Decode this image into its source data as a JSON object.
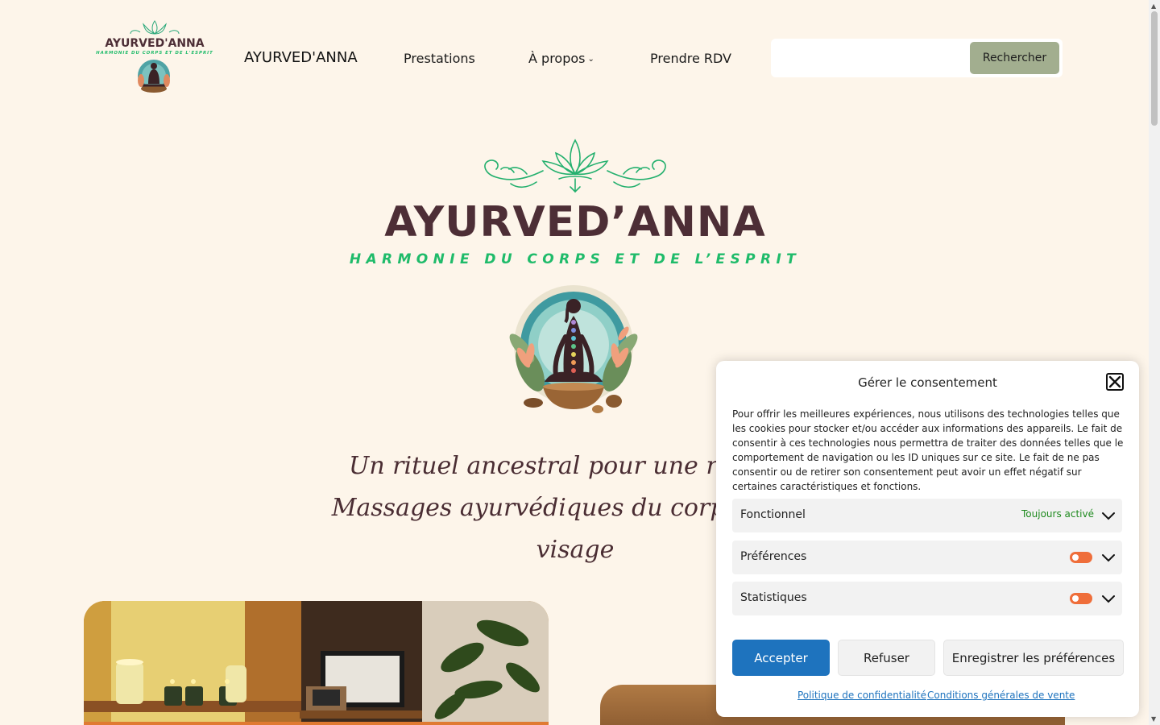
{
  "header": {
    "logo_text": "AYURVED'ANNA",
    "logo_tagline": "HARMONIE DU CORPS ET DE L'ESPRIT",
    "site_title": "AYURVED'ANNA",
    "nav": [
      {
        "label": "Prestations"
      },
      {
        "label": "À propos",
        "has_dropdown": true
      },
      {
        "label": "Prendre RDV"
      }
    ],
    "search": {
      "value": "",
      "placeholder": "",
      "button_label": "Rechercher"
    }
  },
  "hero": {
    "title": "AYURVED’ANNA",
    "subtitle": "HARMONIE DU CORPS ET DE L’ESPRIT",
    "tagline_lines": [
      "Un rituel ancestral pour une relation",
      "Massages ayurvédiques du corps entier",
      "visage"
    ]
  },
  "consent": {
    "title": "Gérer le consentement",
    "text": "Pour offrir les meilleures expériences, nous utilisons des technologies telles que les cookies pour stocker et/ou accéder aux informations des appareils. Le fait de consentir à ces technologies nous permettra de traiter des données telles que le comportement de navigation ou les ID uniques sur ce site. Le fait de ne pas consentir ou de retirer son consentement peut avoir un effet négatif sur certaines caractéristiques et fonctions.",
    "categories": [
      {
        "label": "Fonctionnel",
        "status": "Toujours activé"
      },
      {
        "label": "Préférences",
        "enabled": false
      },
      {
        "label": "Statistiques",
        "enabled": false
      }
    ],
    "buttons": {
      "accept": "Accepter",
      "refuse": "Refuser",
      "save": "Enregistrer les préférences"
    },
    "links": {
      "privacy": "Politique de confidentialité",
      "terms": "Conditions générales de vente"
    }
  },
  "colors": {
    "background": "#fdf5ea",
    "brand_plum": "#4d2e36",
    "brand_green": "#1fbb6a",
    "search_button": "#a2ae8f",
    "accept_button": "#1e73be",
    "toggle_off": "#ef6e3a"
  }
}
